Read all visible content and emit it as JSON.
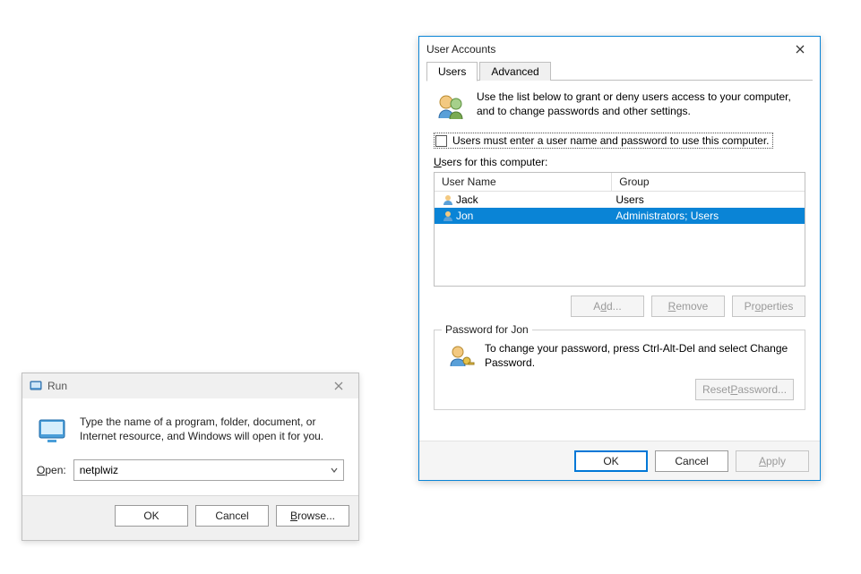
{
  "run": {
    "title": "Run",
    "description": "Type the name of a program, folder, document, or Internet resource, and Windows will open it for you.",
    "open_label_prefix": "O",
    "open_label_rest": "pen:",
    "value": "netplwiz",
    "ok": "OK",
    "cancel": "Cancel",
    "browse_prefix": "B",
    "browse_rest": "rowse..."
  },
  "ua": {
    "title": "User Accounts",
    "tabs": {
      "users": "Users",
      "advanced": "Advanced"
    },
    "info_text": "Use the list below to grant or deny users access to your computer, and to change passwords and other settings.",
    "checkbox_label": "Users must enter a user name and password to use this computer.",
    "users_for_prefix": "U",
    "users_for_rest": "sers for this computer:",
    "columns": {
      "name": "User Name",
      "group": "Group"
    },
    "rows": [
      {
        "name": "Jack",
        "group": "Users",
        "selected": false
      },
      {
        "name": "Jon",
        "group": "Administrators; Users",
        "selected": true
      }
    ],
    "buttons": {
      "add_prefix": "d",
      "add_before": "A",
      "add_after": "d...",
      "remove_prefix": "R",
      "remove_rest": "emove",
      "properties_prefix": "o",
      "properties_before": "Pr",
      "properties_after": "perties",
      "reset_pw": "Reset Password...",
      "reset_pw_prefix": "P",
      "reset_pw_before": "Reset ",
      "reset_pw_after": "assword..."
    },
    "password_legend": "Password for Jon",
    "password_text": "To change your password, press Ctrl-Alt-Del and select Change Password.",
    "footer": {
      "ok": "OK",
      "cancel": "Cancel",
      "apply": "Apply",
      "apply_prefix": "A",
      "apply_rest": "pply"
    }
  }
}
